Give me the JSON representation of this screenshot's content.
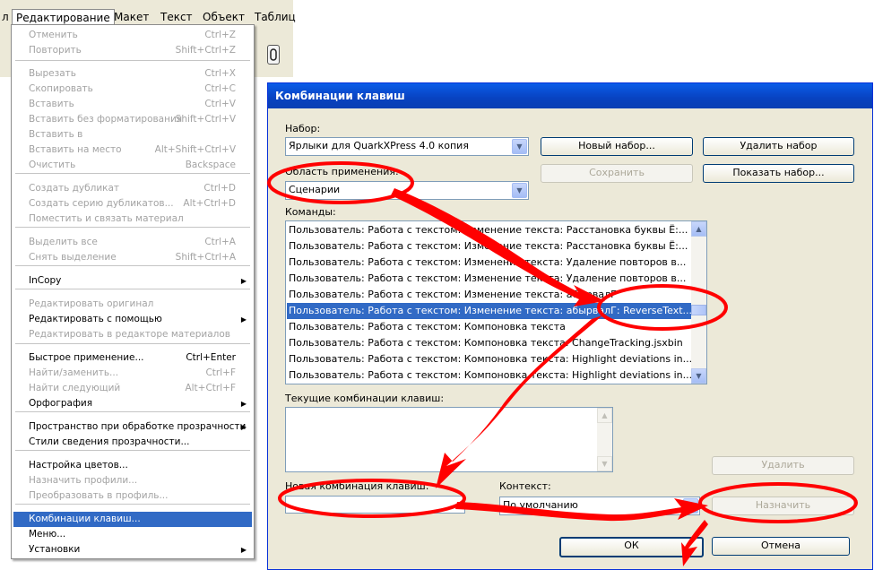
{
  "menubar": {
    "items": [
      "л",
      "Редактирование",
      "Макет",
      "Текст",
      "Объект",
      "Таблиц"
    ]
  },
  "edit_menu": {
    "items": [
      {
        "label": "Отменить",
        "shortcut": "Ctrl+Z",
        "disabled": true
      },
      {
        "label": "Повторить",
        "shortcut": "Shift+Ctrl+Z",
        "disabled": true
      },
      {
        "label": "Вырезать",
        "shortcut": "Ctrl+X",
        "disabled": true
      },
      {
        "label": "Скопировать",
        "shortcut": "Ctrl+C",
        "disabled": true
      },
      {
        "label": "Вставить",
        "shortcut": "Ctrl+V",
        "disabled": true
      },
      {
        "label": "Вставить без форматирования",
        "shortcut": "Shift+Ctrl+V",
        "disabled": true
      },
      {
        "label": "Вставить в",
        "shortcut": "",
        "disabled": true
      },
      {
        "label": "Вставить на место",
        "shortcut": "Alt+Shift+Ctrl+V",
        "disabled": true
      },
      {
        "label": "Очистить",
        "shortcut": "Backspace",
        "disabled": true
      },
      {
        "label": "Создать дубликат",
        "shortcut": "Ctrl+D",
        "disabled": true
      },
      {
        "label": "Создать серию дубликатов...",
        "shortcut": "Alt+Ctrl+D",
        "disabled": true
      },
      {
        "label": "Поместить и связать материал",
        "shortcut": "",
        "disabled": true
      },
      {
        "label": "Выделить все",
        "shortcut": "Ctrl+A",
        "disabled": true
      },
      {
        "label": "Снять выделение",
        "shortcut": "Shift+Ctrl+A",
        "disabled": true
      },
      {
        "label": "InCopy",
        "shortcut": "",
        "disabled": false,
        "submenu": true
      },
      {
        "label": "Редактировать оригинал",
        "shortcut": "",
        "disabled": true
      },
      {
        "label": "Редактировать с помощью",
        "shortcut": "",
        "disabled": false,
        "submenu": true
      },
      {
        "label": "Редактировать в редакторе материалов",
        "shortcut": "",
        "disabled": true
      },
      {
        "label": "Быстрое применение...",
        "shortcut": "Ctrl+Enter",
        "disabled": false
      },
      {
        "label": "Найти/заменить...",
        "shortcut": "Ctrl+F",
        "disabled": true
      },
      {
        "label": "Найти следующий",
        "shortcut": "Alt+Ctrl+F",
        "disabled": true
      },
      {
        "label": "Орфография",
        "shortcut": "",
        "disabled": false,
        "submenu": true
      },
      {
        "label": "Пространство при обработке прозрачности",
        "shortcut": "",
        "disabled": false,
        "submenu": true
      },
      {
        "label": "Стили сведения прозрачности...",
        "shortcut": "",
        "disabled": false
      },
      {
        "label": "Настройка цветов...",
        "shortcut": "",
        "disabled": false
      },
      {
        "label": "Назначить профили...",
        "shortcut": "",
        "disabled": true
      },
      {
        "label": "Преобразовать в профиль...",
        "shortcut": "",
        "disabled": true
      },
      {
        "label": "Комбинации клавиш...",
        "shortcut": "",
        "disabled": false,
        "selected": true
      },
      {
        "label": "Меню...",
        "shortcut": "",
        "disabled": false
      },
      {
        "label": "Установки",
        "shortcut": "",
        "disabled": false,
        "submenu": true
      }
    ]
  },
  "dialog": {
    "title": "Комбинации клавиш",
    "set_label": "Набор:",
    "set_value": "Ярлыки для QuarkXPress 4.0 копия",
    "new_set": "Новый набор...",
    "delete_set": "Удалить набор",
    "save": "Сохранить",
    "show_set": "Показать набор...",
    "area_label": "Область применения:",
    "area_value": "Сценарии",
    "commands_label": "Команды:",
    "commands": [
      "Пользователь: Работа с текстом: Изменение текста: Расстановка буквы Ё:...",
      "Пользователь: Работа с текстом: Изменение текста: Расстановка буквы Ё:...",
      "Пользователь: Работа с текстом: Изменение текста: Удаление повторов в...",
      "Пользователь: Работа с текстом: Изменение текста: Удаление повторов в...",
      "Пользователь: Работа с текстом: Изменение текста: абырвалГ",
      "Пользователь: Работа с текстом: Изменение текста: абырвалГ: ReverseText...",
      "Пользователь: Работа с текстом: Компоновка текста",
      "Пользователь: Работа с текстом: Компоновка текста: ChangeTracking.jsxbin",
      "Пользователь: Работа с текстом: Компоновка текста: Highlight deviations in...",
      "Пользователь: Работа с текстом: Компоновка текста: Highlight deviations in..."
    ],
    "selected_command_index": 5,
    "current_label": "Текущие комбинации клавиш:",
    "remove": "Удалить",
    "new_combo_label": "Новая комбинация клавиш:",
    "new_combo_value": "",
    "context_label": "Контекст:",
    "context_value": "По умолчанию",
    "assign": "Назначить",
    "ok": "ОК",
    "cancel": "Отмена"
  },
  "colors": {
    "selection": "#316ac5",
    "annotation": "#ff0000",
    "dialog_bg": "#ece9d8",
    "titlebar": "#0a5ce8"
  }
}
